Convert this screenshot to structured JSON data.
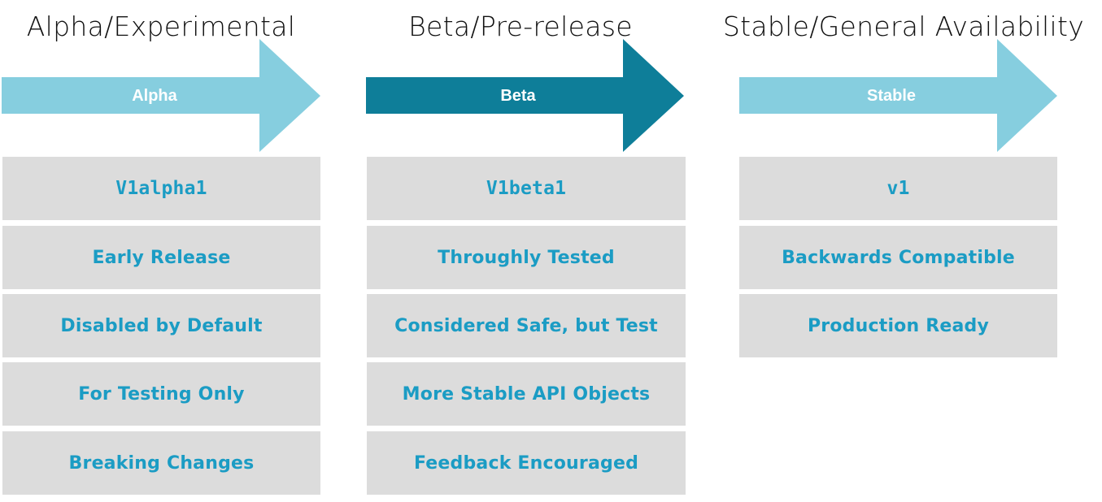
{
  "colors": {
    "alpha_arrow": "#86cedf",
    "beta_arrow": "#0e7e99",
    "stable_arrow": "#86cedf",
    "box_fill": "#dcdcdc",
    "box_text": "#1b9cc4",
    "title_text": "#111111"
  },
  "stages": [
    {
      "title": "Alpha/Experimental",
      "arrow_label": "Alpha",
      "version": "V1alpha1",
      "traits": [
        "Early Release",
        "Disabled by Default",
        "For Testing Only",
        "Breaking Changes"
      ]
    },
    {
      "title": "Beta/Pre-release",
      "arrow_label": "Beta",
      "version": "V1beta1",
      "traits": [
        "Throughly Tested",
        "Considered Safe, but Test",
        "More Stable API Objects",
        "Feedback Encouraged"
      ]
    },
    {
      "title": "Stable/General Availability",
      "arrow_label": "Stable",
      "version": "v1",
      "traits": [
        "Backwards Compatible",
        "Production Ready"
      ]
    }
  ]
}
